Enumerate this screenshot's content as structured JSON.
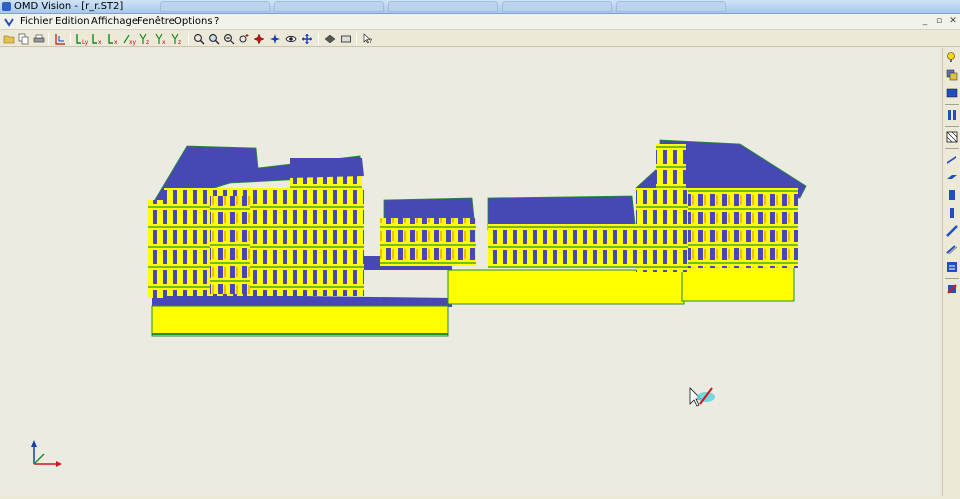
{
  "window": {
    "title": "OMD Vision - [r_r.ST2]"
  },
  "menu": {
    "items": [
      "Fichier",
      "Edition",
      "Affichage",
      "Fenêtre",
      "Options",
      "?"
    ]
  },
  "window_controls": {
    "minimize": "_",
    "restore": "▫",
    "close": "✕"
  },
  "toolbar": {
    "axis_labels": [
      "Ly",
      "Lx",
      "Lx",
      "xy",
      "Yz",
      "Yx",
      "Yz"
    ]
  },
  "colors": {
    "wall_yellow": "#ffff00",
    "slab_blue": "#4848b4",
    "edge_green": "#1f8f2f",
    "accent_red": "#d01818"
  }
}
